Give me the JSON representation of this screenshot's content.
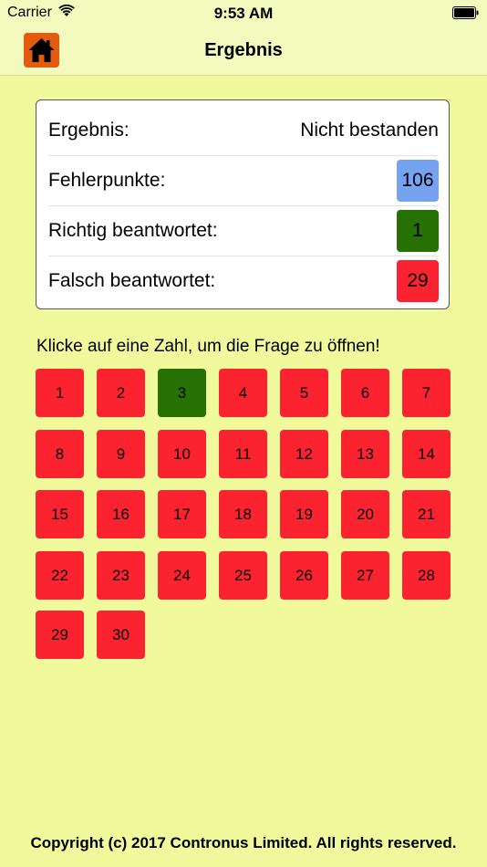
{
  "status_bar": {
    "carrier": "Carrier",
    "time": "9:53 AM"
  },
  "nav": {
    "title": "Ergebnis",
    "home_icon": "home-icon",
    "home_color": "#e35b0f"
  },
  "result": {
    "rows": [
      {
        "label": "Ergebnis:",
        "value": "Nicht bestanden"
      },
      {
        "label": "Fehlerpunkte:",
        "value": "106",
        "color": "#75a3f0"
      },
      {
        "label": "Richtig beantwortet:",
        "value": "1",
        "color": "#267004"
      },
      {
        "label": "Falsch beantwortet:",
        "value": "29",
        "color": "#fb2330"
      }
    ]
  },
  "instruction": "Klicke auf eine Zahl, um die Frage zu öffnen!",
  "colors": {
    "correct": "#267004",
    "wrong": "#fb2330",
    "background": "#f0fa9c"
  },
  "questions": [
    {
      "label": "1",
      "status": "wrong"
    },
    {
      "label": "2",
      "status": "wrong"
    },
    {
      "label": "3",
      "status": "correct"
    },
    {
      "label": "4",
      "status": "wrong"
    },
    {
      "label": "5",
      "status": "wrong"
    },
    {
      "label": "6",
      "status": "wrong"
    },
    {
      "label": "7",
      "status": "wrong"
    },
    {
      "label": "8",
      "status": "wrong"
    },
    {
      "label": "9",
      "status": "wrong"
    },
    {
      "label": "10",
      "status": "wrong"
    },
    {
      "label": "11",
      "status": "wrong"
    },
    {
      "label": "12",
      "status": "wrong"
    },
    {
      "label": "13",
      "status": "wrong"
    },
    {
      "label": "14",
      "status": "wrong"
    },
    {
      "label": "15",
      "status": "wrong"
    },
    {
      "label": "16",
      "status": "wrong"
    },
    {
      "label": "17",
      "status": "wrong"
    },
    {
      "label": "18",
      "status": "wrong"
    },
    {
      "label": "19",
      "status": "wrong"
    },
    {
      "label": "20",
      "status": "wrong"
    },
    {
      "label": "21",
      "status": "wrong"
    },
    {
      "label": "22",
      "status": "wrong"
    },
    {
      "label": "23",
      "status": "wrong"
    },
    {
      "label": "24",
      "status": "wrong"
    },
    {
      "label": "25",
      "status": "wrong"
    },
    {
      "label": "26",
      "status": "wrong"
    },
    {
      "label": "27",
      "status": "wrong"
    },
    {
      "label": "28",
      "status": "wrong"
    },
    {
      "label": "29",
      "status": "wrong"
    },
    {
      "label": "30",
      "status": "wrong"
    }
  ],
  "footer": "Copyright (c) 2017 Contronus Limited. All rights reserved."
}
